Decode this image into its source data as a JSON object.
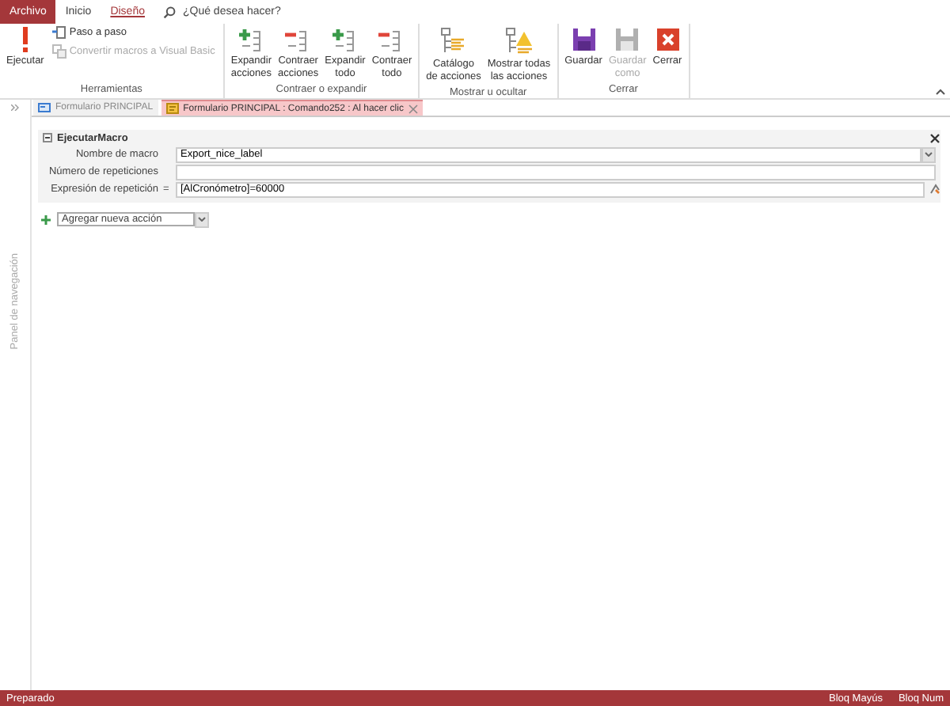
{
  "menu_tabs": [
    {
      "label": "Archivo",
      "kind": "file",
      "selected": false
    },
    {
      "label": "Inicio",
      "kind": "tab",
      "selected": false
    },
    {
      "label": "Diseño",
      "kind": "tab",
      "selected": true
    }
  ],
  "tell_me": {
    "placeholder": "¿Qué desea hacer?"
  },
  "ribbon": {
    "groups": [
      {
        "title": "Herramientas",
        "buttons": [
          {
            "label": "Ejecutar",
            "kind": "run",
            "disabled": false
          },
          {
            "label": "Paso a paso",
            "kind": "step",
            "disabled": false
          },
          {
            "label": "Convertir macros a Visual Basic",
            "kind": "convert",
            "disabled": true
          }
        ]
      },
      {
        "title": "Contraer o expandir",
        "buttons": [
          {
            "label": "Expandir\nacciones",
            "kind": "expand",
            "disabled": false
          },
          {
            "label": "Contraer\nacciones",
            "kind": "collapse",
            "disabled": false
          },
          {
            "label": "Expandir\ntodo",
            "kind": "expand",
            "disabled": false
          },
          {
            "label": "Contraer\ntodo",
            "kind": "collapse",
            "disabled": false
          }
        ]
      },
      {
        "title": "Mostrar u ocultar",
        "buttons": [
          {
            "label": "Catálogo\nde acciones",
            "kind": "catalog",
            "disabled": false
          },
          {
            "label": "Mostrar todas\nlas acciones",
            "kind": "showall",
            "disabled": false
          }
        ]
      },
      {
        "title": "Cerrar",
        "buttons": [
          {
            "label": "Guardar",
            "kind": "save",
            "disabled": false
          },
          {
            "label": "Guardar\ncomo",
            "kind": "save",
            "disabled": true
          },
          {
            "label": "Cerrar",
            "kind": "close",
            "disabled": false
          }
        ]
      }
    ]
  },
  "doc_tabs": [
    {
      "label": "Formulario PRINCIPAL",
      "kind": "form",
      "selected": false
    },
    {
      "label": "Formulario PRINCIPAL : Comando252 : Al hacer clic",
      "kind": "macro",
      "selected": true
    }
  ],
  "nav_pane": {
    "label": "Panel de navegación"
  },
  "macro": {
    "title": "EjecutarMacro",
    "expanded": true,
    "fields": [
      {
        "label": "Nombre de macro",
        "kind": "dropdown",
        "value": "Export_nice_label"
      },
      {
        "label": "Número de repeticiones",
        "kind": "text"
      },
      {
        "label": "Expresión de repetición",
        "kind": "builder",
        "prefix": "=",
        "value": "[AlCronómetro]=60000"
      }
    ]
  },
  "add_action": {
    "placeholder": "Agregar nueva acción"
  },
  "status_bar": {
    "left": "Preparado",
    "right": [
      "Bloq Mayús",
      "Bloq Num"
    ]
  }
}
